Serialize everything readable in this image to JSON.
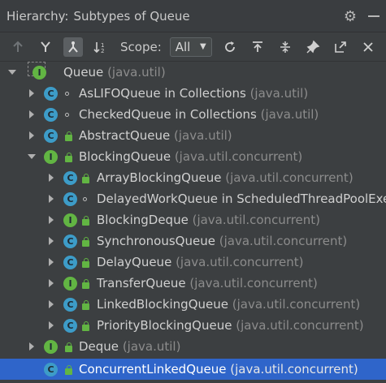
{
  "window": {
    "title": "Hierarchy:",
    "subtitle": "Subtypes of Queue"
  },
  "toolbar": {
    "scope_label": "Scope:",
    "scope_value": "All"
  },
  "tree": {
    "items": [
      {
        "name": "Queue",
        "pkg": "(java.util)",
        "type": "iface"
      },
      {
        "name": "AsLIFOQueue in Collections",
        "pkg": "(java.util)",
        "type": "class"
      },
      {
        "name": "CheckedQueue in Collections",
        "pkg": "(java.util)",
        "type": "class"
      },
      {
        "name": "AbstractQueue",
        "pkg": "(java.util)",
        "type": "class"
      },
      {
        "name": "BlockingQueue",
        "pkg": "(java.util.concurrent)",
        "type": "iface"
      },
      {
        "name": "ArrayBlockingQueue",
        "pkg": "(java.util.concurrent)",
        "type": "class"
      },
      {
        "name": "DelayedWorkQueue in ScheduledThreadPoolExe",
        "pkg": "",
        "type": "class"
      },
      {
        "name": "BlockingDeque",
        "pkg": "(java.util.concurrent)",
        "type": "iface"
      },
      {
        "name": "SynchronousQueue",
        "pkg": "(java.util.concurrent)",
        "type": "class"
      },
      {
        "name": "DelayQueue",
        "pkg": "(java.util.concurrent)",
        "type": "class"
      },
      {
        "name": "TransferQueue",
        "pkg": "(java.util.concurrent)",
        "type": "iface"
      },
      {
        "name": "LinkedBlockingQueue",
        "pkg": "(java.util.concurrent)",
        "type": "class"
      },
      {
        "name": "PriorityBlockingQueue",
        "pkg": "(java.util.concurrent)",
        "type": "class"
      },
      {
        "name": "Deque",
        "pkg": "(java.util)",
        "type": "iface"
      },
      {
        "name": "ConcurrentLinkedQueue",
        "pkg": "(java.util.concurrent)",
        "type": "class"
      }
    ]
  },
  "colors": {
    "selection": "#2f65ca",
    "class_icon": "#3d9cc8",
    "interface_icon": "#62b543"
  }
}
